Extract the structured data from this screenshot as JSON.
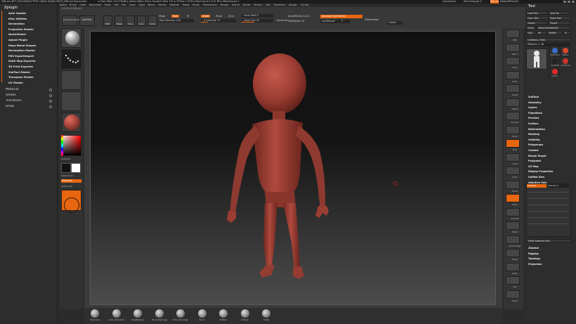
{
  "titlebar": {
    "left": "ZBrush 4R7  [4412DQ44 TP4F-Q4D4-4Q4D-D4F4]   ZBrush Document",
    "stats": "▸ Free Mem 10.474GB ▸ Active Mem 424 ▸ Scratch Disk 151 ▸ ZTime 1.259 ▸ PolyCount 4.212 KP ▸ MeshCount 1",
    "quicksave": "QuickSave",
    "see_through": "See-through  0",
    "menus": "Menus",
    "default_zscript": "DefaultZScript"
  },
  "menubar": [
    "Alpha",
    "Brush",
    "Color",
    "Document",
    "Draw",
    "Edit",
    "File",
    "Layer",
    "Light",
    "Macro",
    "Marker",
    "Material",
    "Movie",
    "Picker",
    "Preferences",
    "Render",
    "Stencil",
    "Stroke",
    "Texture",
    "Tool",
    "Transform",
    "Zplugin",
    "Zscript"
  ],
  "coords": "-1.2 91,-0.718,-0.1",
  "leftpanel": {
    "title": "Zplugin",
    "plugins": [
      "Auto Update",
      "Misc Utilities",
      "Decimation",
      "Projection Master",
      "QuickSketch",
      "Adjust Plugin",
      "Maya Blend Shapes",
      "Decimation Master",
      "FBX ExportImport",
      "Multi Map Exporter",
      "3D Print Exporter",
      "SubTool Master",
      "Transpose Master",
      "UV Master"
    ],
    "categories": [
      "Material",
      "Stroke",
      "Transform",
      "Draw"
    ]
  },
  "shelf": {
    "projection_master": "Projection Master",
    "lightbox": "LightBox",
    "edit": "Edit",
    "draw": "Draw",
    "move": "Move",
    "scale": "Scale",
    "rotate": "Rotate",
    "mrgb": "Mrgb",
    "rgb": "Rgb",
    "m": "M",
    "zadd": "Zadd",
    "zsub": "Zsub",
    "zcut": "Zcut",
    "rgb_intensity": "Rgb Intensity 100",
    "z_intensity": "Z Intensity 17",
    "focal_shift": "Focal Shift 0",
    "draw_size": "Draw Size 22",
    "dynamic": "Dynamic",
    "active_points": "ActivePoints: 8,212",
    "total_points": "TotalPoints: 24",
    "activate_symmetry": "Activate Symmetry",
    "lazy_mouse": "LazyMouse",
    "lazy_value": "9",
    "zremesher": "ZRemesher",
    "subdiv": "SubDiv"
  },
  "lefttray": {
    "gradient": "Gradient",
    "switch_color": "SwitchColor",
    "alternate": "Alternate",
    "texture_off": "Texture Off"
  },
  "righttray": [
    "BPR",
    "SPix 3",
    "Scroll",
    "Zoom",
    "Actual",
    "AAHalf",
    "Dynamic",
    "Persp",
    "Floor",
    "Local",
    "Gizmo",
    "Frame",
    "Move",
    "Zoom3D",
    "Rotate",
    "Line Fill PolyF",
    "Transp",
    "Ghost",
    "Solo",
    "Xpose"
  ],
  "toolpanel": {
    "title": "Tool",
    "load_tool": "Load Tool",
    "save_as": "Save As",
    "copy_tool": "Copy Tool",
    "paste_tool": "Paste Tool",
    "import": "Import",
    "export": "Export",
    "clone": "Clone",
    "make_polymesh": "Make PolyMesh3D",
    "goz": "GoZ",
    "all": "All",
    "visible": "Visible",
    "lightbox_tools": "Lightbox ▸ Tools",
    "zsphere": "ZSphere_1. 48",
    "tool_thumbs": [
      "ZSphere_1",
      "Simple Brush",
      "ZSphere",
      "Cylinder3D",
      "PolyMesh3D",
      "Dynamic"
    ],
    "tool_r": "R",
    "subpalettes": [
      "SubTool",
      "Geometry",
      "Layers",
      "FiberMesh",
      "Preview",
      "Surface",
      "Deformation",
      "Masking",
      "Visibility",
      "Polygroups",
      "Contact",
      "Morph Target",
      "Polypaint",
      "UV Map",
      "Display Properties",
      "Unified Skin",
      "Adaptive Skin"
    ],
    "preview_btn": "Preview",
    "density": "Density 2",
    "make_adaptive_skin": "Make Adaptive Skin",
    "subpalettes2": [
      "ZSketch",
      "Rigging",
      "Topology",
      "Projection"
    ]
  },
  "bottomshelf": [
    "Standard",
    "Dam_Standard",
    "ClayBuildup",
    "Move Topological",
    "Move Topological",
    "Pinch",
    "Flatten",
    "hPolish",
    "Inflat"
  ],
  "colors": {
    "accent": "#e8660f",
    "model": "#a4433a",
    "bg": "#2b2b2b"
  }
}
